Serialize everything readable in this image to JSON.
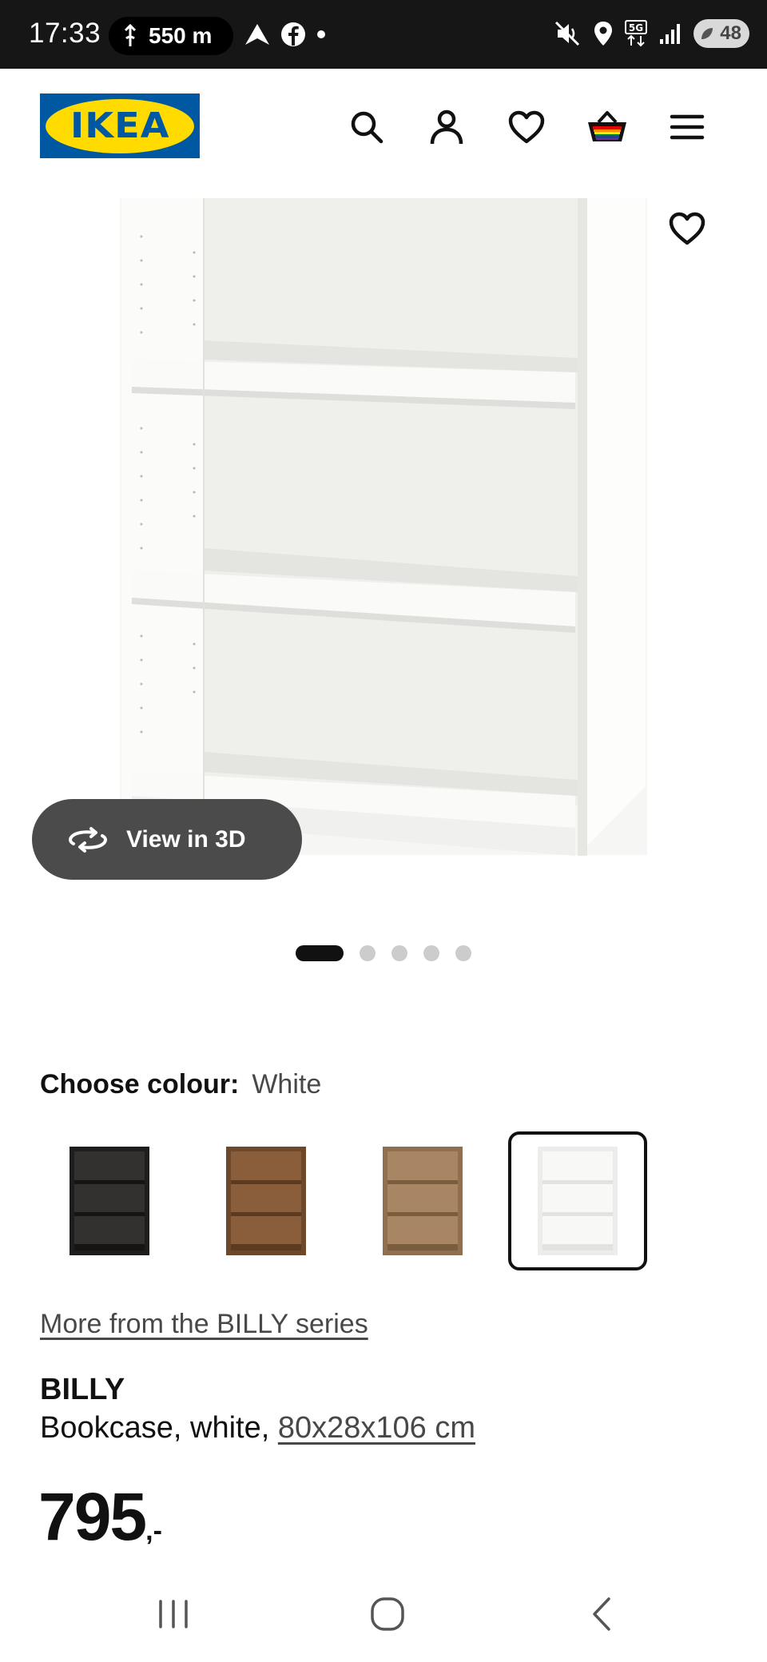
{
  "status_bar": {
    "time": "17:33",
    "distance": "550 m",
    "battery": "48",
    "icons": [
      "navigation-icon",
      "maps-icon",
      "facebook-icon",
      "dot-icon",
      "mute-icon",
      "location-icon",
      "5g-icon",
      "signal-icon",
      "battery-icon"
    ]
  },
  "header": {
    "logo_text": "IKEA",
    "icons": [
      "search-icon",
      "account-icon",
      "heart-icon",
      "basket-icon",
      "menu-icon"
    ],
    "brand_blue": "#0058a3",
    "brand_yellow": "#ffdb00"
  },
  "gallery": {
    "view_3d_label": "View in 3D",
    "image_count": 5,
    "active_index": 0
  },
  "colour": {
    "label": "Choose colour:",
    "selected": "White",
    "swatches": [
      {
        "name": "black-brown",
        "color": "#2b2a29"
      },
      {
        "name": "brown walnut",
        "color": "#7a5233"
      },
      {
        "name": "oak effect",
        "color": "#9c7a58"
      },
      {
        "name": "white",
        "color": "#f4f4f2"
      }
    ]
  },
  "product": {
    "series_link": "More from the BILLY series",
    "name": "BILLY",
    "description": "Bookcase, white,",
    "size": "80x28x106 cm",
    "price": "795",
    "price_suffix": ",-"
  },
  "navbar": {
    "icons": [
      "recent-apps-icon",
      "home-icon",
      "back-icon"
    ]
  }
}
